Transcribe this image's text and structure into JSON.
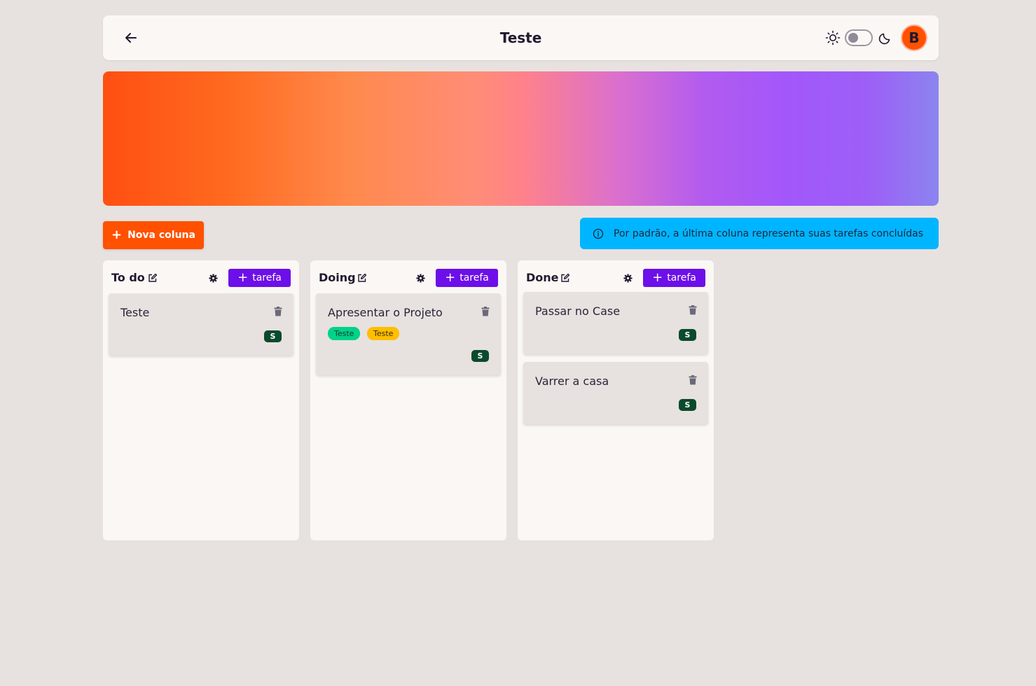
{
  "header": {
    "title": "Teste",
    "back_icon": "arrow-left-icon",
    "theme_light_icon": "sun-icon",
    "theme_dark_icon": "moon-icon",
    "theme_toggle_state": "light",
    "avatar_initial": "B"
  },
  "banner": {
    "colors": [
      "#ff4f12",
      "#ff8a4e",
      "#ff8289",
      "#a257fb",
      "#8b84ef"
    ]
  },
  "toolbar": {
    "new_column_label": "Nova coluna",
    "info_text": "Por padrão, a última coluna representa suas tarefas concluídas",
    "info_icon": "info-icon"
  },
  "columns": [
    {
      "title": "To do",
      "add_task_label": "tarefa",
      "cards": [
        {
          "title": "Teste",
          "tags": [],
          "user": "S"
        }
      ]
    },
    {
      "title": "Doing",
      "add_task_label": "tarefa",
      "cards": [
        {
          "title": "Apresentar o Projeto",
          "tags": [
            {
              "label": "Teste",
              "color": "#00d28a"
            },
            {
              "label": "Teste",
              "color": "#ffbe00"
            }
          ],
          "user": "S"
        }
      ]
    },
    {
      "title": "Done",
      "add_task_label": "tarefa",
      "cards": [
        {
          "title": "Passar no Case",
          "tags": [],
          "user": "S"
        },
        {
          "title": "Varrer a casa",
          "tags": [],
          "user": "S"
        }
      ]
    }
  ],
  "colors": {
    "accent_orange": "#ff5100",
    "accent_purple": "#6d0fe8",
    "info_blue": "#00b5ff",
    "user_badge": "#0b4a2c",
    "background": "#e7e2df",
    "surface": "#faf7f5"
  }
}
